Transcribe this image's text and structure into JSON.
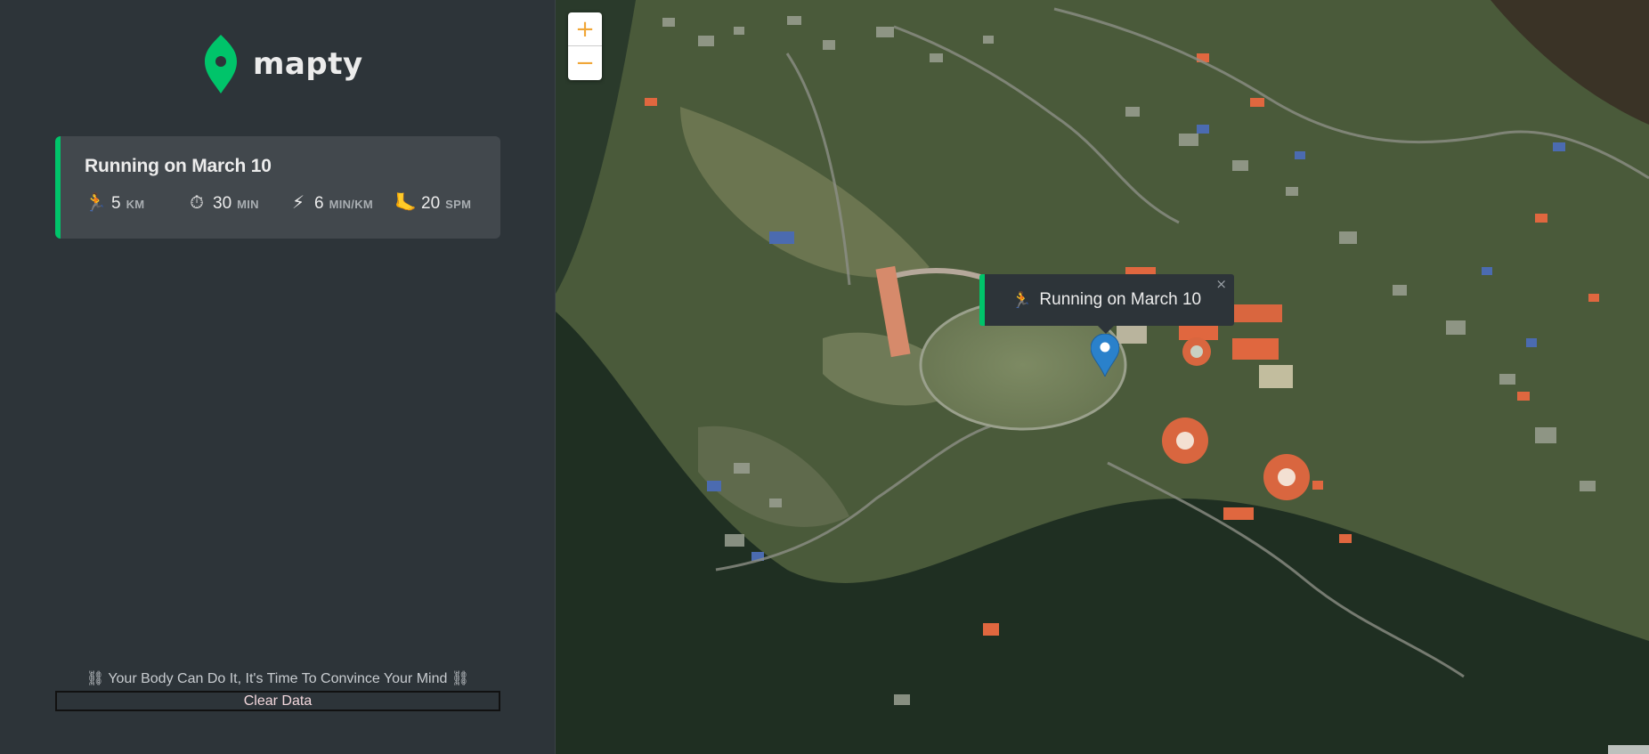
{
  "app": {
    "logo_text": "mapty",
    "brand_color": "#00c46a",
    "logo_icon": "map-pin-icon"
  },
  "workouts": [
    {
      "title": "Running on March 10",
      "type": "running",
      "accent": "#00c46a",
      "details": [
        {
          "icon": "runner-icon",
          "emoji": "🏃",
          "value": "5",
          "unit": "KM"
        },
        {
          "icon": "stopwatch-icon",
          "emoji": "⏱",
          "value": "30",
          "unit": "MIN"
        },
        {
          "icon": "lightning-icon",
          "emoji": "⚡",
          "value": "6",
          "unit": "MIN/KM"
        },
        {
          "icon": "foot-icon",
          "emoji": "🦶",
          "value": "20",
          "unit": "SPM"
        }
      ]
    }
  ],
  "footer": {
    "quote": "⛓ Your Body Can Do It, It's Time To Convince Your Mind ⛓",
    "clear_button": "Clear Data"
  },
  "map": {
    "zoom_in": "+",
    "zoom_out": "−",
    "popup": {
      "emoji": "🏃",
      "text": "Running on March 10",
      "close": "×"
    },
    "marker_icon": "map-marker-icon",
    "marker_color": "#2a81cb",
    "zoom_accent": "#f0a637"
  }
}
